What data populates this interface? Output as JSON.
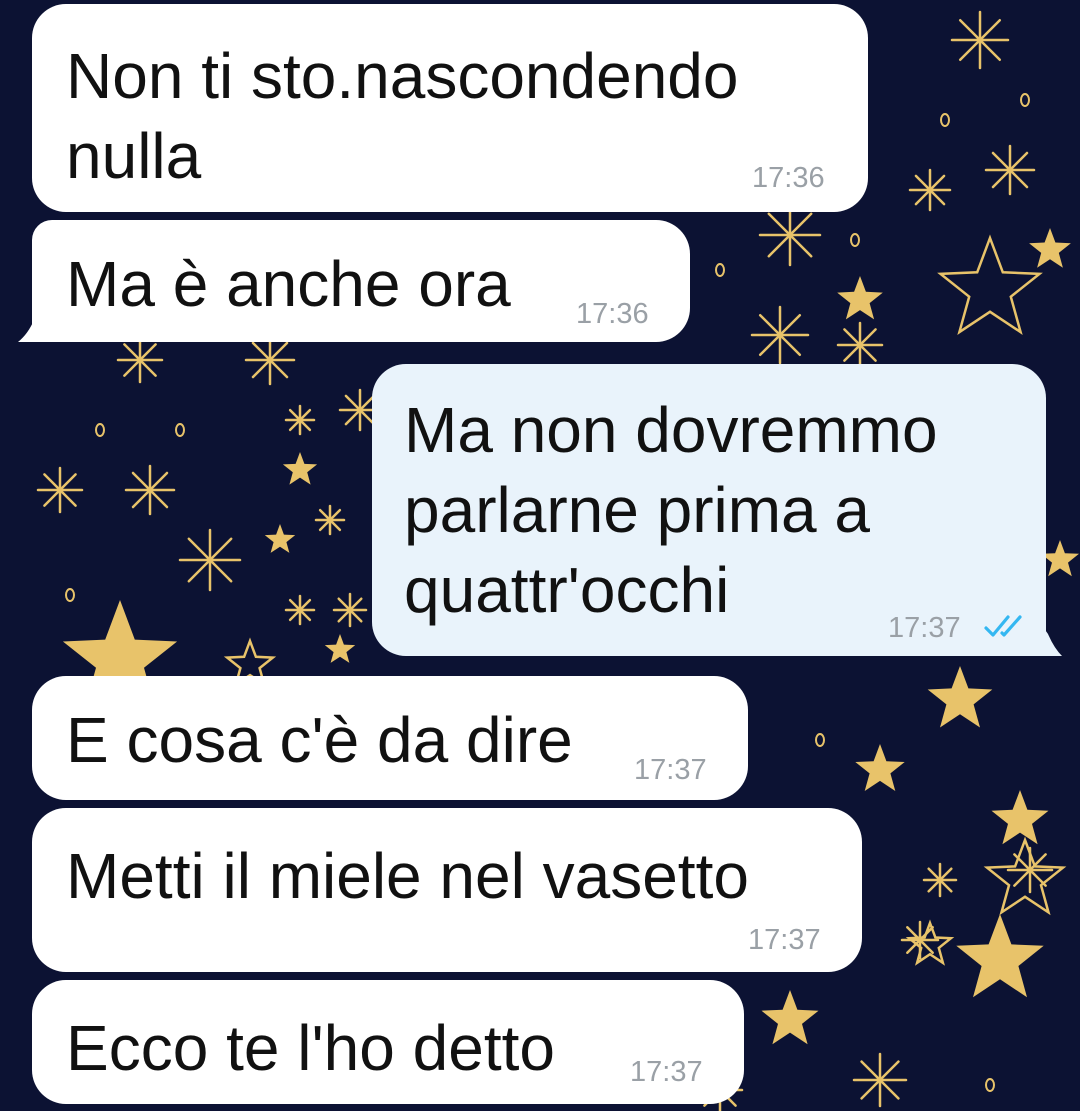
{
  "chat": {
    "messages": [
      {
        "direction": "incoming",
        "text": "Non ti sto.nascondendo\nnulla",
        "time": "17:36"
      },
      {
        "direction": "incoming",
        "text": "Ma è anche ora",
        "time": "17:36"
      },
      {
        "direction": "outgoing",
        "text": "Ma non dovremmo\nparlarne prima a\nquattr'occhi",
        "time": "17:37",
        "status_icon": "double-check-icon",
        "status": "read"
      },
      {
        "direction": "incoming",
        "text": "E cosa c'è da dire",
        "time": "17:37"
      },
      {
        "direction": "incoming",
        "text": "Metti il miele nel vasetto",
        "time": "17:37"
      },
      {
        "direction": "incoming",
        "text": "Ecco te l'ho detto",
        "time": "17:37"
      }
    ]
  },
  "theme": {
    "wallpaper": "stars-on-navy",
    "wallpaper_color": "#0c1233",
    "star_color": "#e8c36a",
    "incoming_bubble": "#ffffff",
    "outgoing_bubble": "#e9f3fb",
    "read_tick_color": "#34b7f1"
  }
}
